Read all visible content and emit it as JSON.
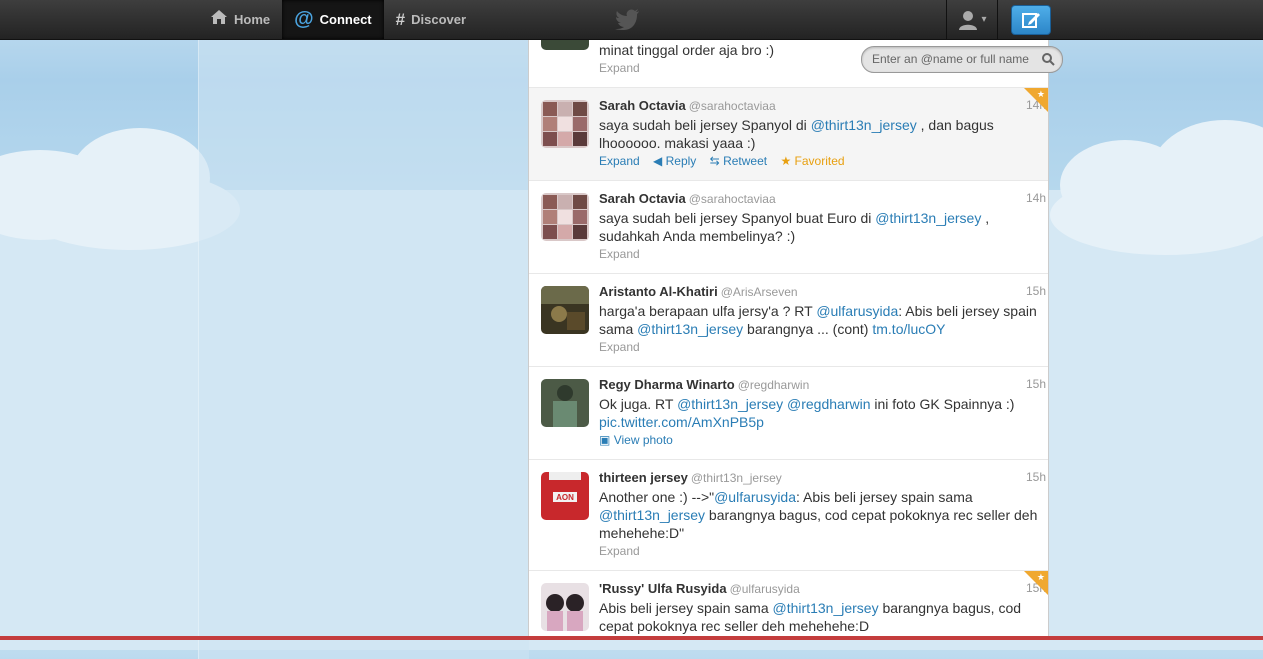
{
  "nav": {
    "home_label": "Home",
    "connect_label": "Connect",
    "discover_label": "Discover"
  },
  "search": {
    "placeholder": "Enter an @name or full name"
  },
  "colors": {
    "link": "#2a7db5",
    "favorited": "#e8a010",
    "compose": "#2c86c8"
  },
  "tweets": [
    {
      "name": "",
      "handle": "",
      "time": "",
      "text": "minat tinggal order aja bro :)",
      "expand": "Expand"
    },
    {
      "name": "Sarah Octavia",
      "handle": "@sarahoctaviaa",
      "time": "14h",
      "text_a": "saya sudah beli jersey Spanyol di ",
      "mention": "@thirt13n_jersey",
      "text_b": " , dan bagus lhoooooo. makasi yaaa :)",
      "expand": "Expand",
      "reply": "Reply",
      "retweet": "Retweet",
      "favorited": "Favorited"
    },
    {
      "name": "Sarah Octavia",
      "handle": "@sarahoctaviaa",
      "time": "14h",
      "text_a": "saya sudah beli jersey Spanyol buat Euro di ",
      "mention": "@thirt13n_jersey",
      "text_b": " , sudahkah Anda membelinya? :)",
      "expand": "Expand"
    },
    {
      "name": "Aristanto Al-Khatiri",
      "handle": "@ArisArseven",
      "time": "15h",
      "text_a": "harga'a berapaan ulfa jersy'a ? RT ",
      "mention1": "@ulfarusyida",
      "text_b": ": Abis beli jersey spain sama ",
      "mention2": "@thirt13n_jersey",
      "text_c": " barangnya ... (cont) ",
      "url": "tm.to/lucOY",
      "expand": "Expand"
    },
    {
      "name": "Regy Dharma Winarto",
      "handle": "@regdharwin",
      "time": "15h",
      "text_a": "Ok juga. RT ",
      "mention1": "@thirt13n_jersey",
      "mention2": "@regdharwin",
      "text_b": " ini foto GK Spainnya :) ",
      "url": "pic.twitter.com/AmXnPB5p",
      "view_photo": "View photo"
    },
    {
      "name": "thirteen jersey",
      "handle": "@thirt13n_jersey",
      "time": "15h",
      "text_a": "Another one :) -->\"",
      "mention1": "@ulfarusyida",
      "text_b": ": Abis beli jersey spain sama ",
      "mention2": "@thirt13n_jersey",
      "text_c": " barangnya bagus, cod cepat pokoknya rec seller deh mehehehe:D\"",
      "expand": "Expand"
    },
    {
      "name": "'Russy' Ulfa Rusyida",
      "handle": "@ulfarusyida",
      "time": "15h",
      "text_a": "Abis beli jersey spain sama ",
      "mention": "@thirt13n_jersey",
      "text_b": " barangnya bagus, cod cepat pokoknya rec seller deh mehehehe:D"
    }
  ]
}
